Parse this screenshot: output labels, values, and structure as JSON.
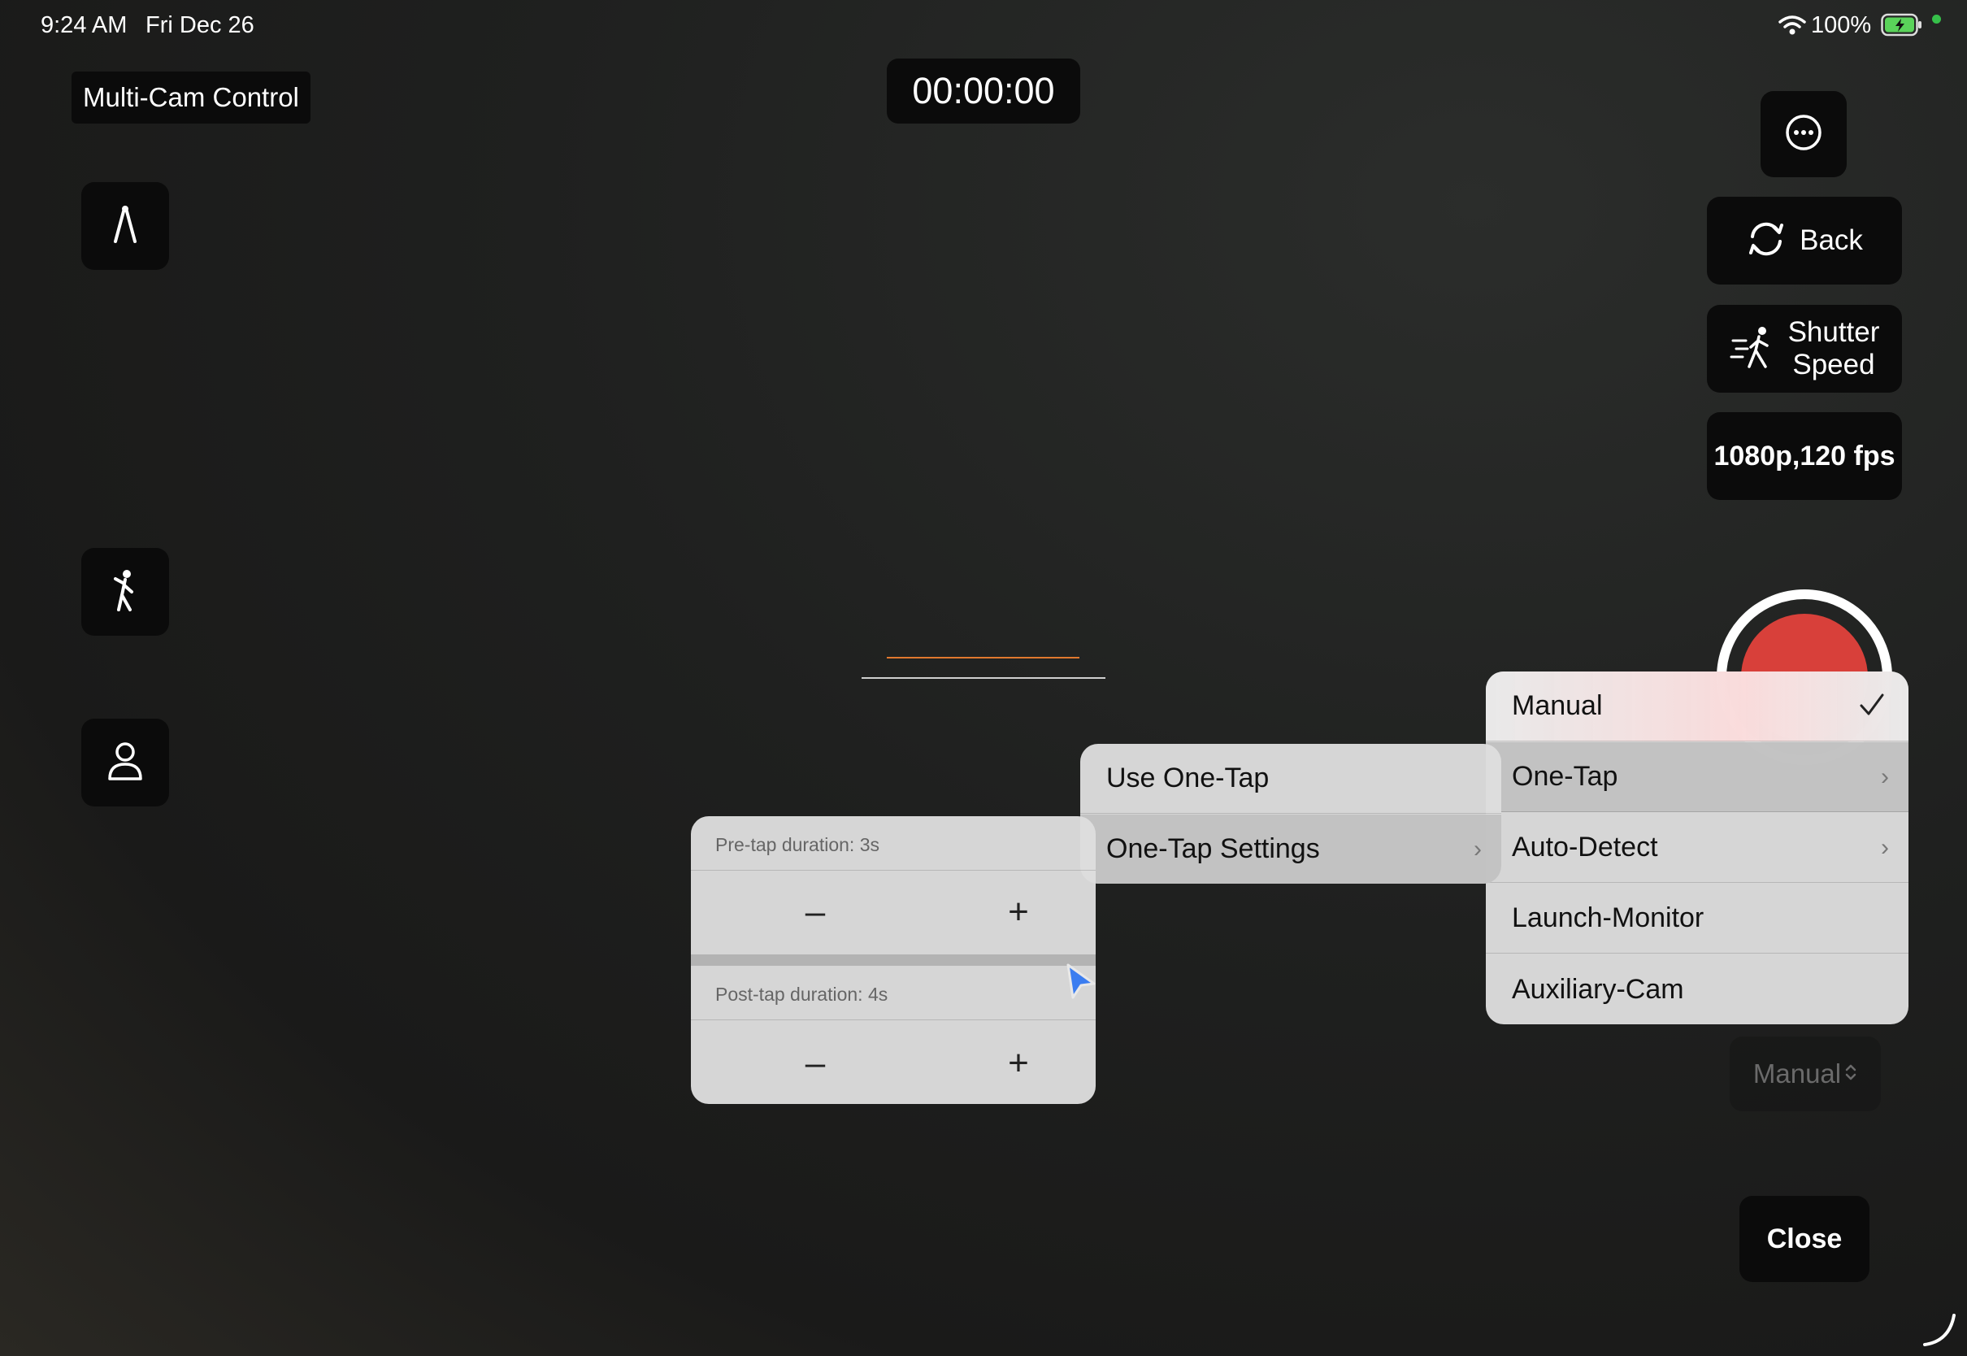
{
  "status_bar": {
    "time": "9:24 AM",
    "date": "Fri Dec 26",
    "battery": "100%"
  },
  "header": {
    "title": "Multi-Cam Control",
    "timer": "00:00:00"
  },
  "right_controls": {
    "back_label": "Back",
    "shutter_label_line1": "Shutter",
    "shutter_label_line2": "Speed",
    "format_label": "1080p,120 fps",
    "mode_selector_label": "Manual",
    "close_label": "Close"
  },
  "mode_menu": {
    "items": [
      {
        "label": "Manual",
        "checked": true
      },
      {
        "label": "One-Tap",
        "submenu": true
      },
      {
        "label": "Auto-Detect",
        "submenu": true
      },
      {
        "label": "Launch-Monitor"
      },
      {
        "label": "Auxiliary-Cam"
      }
    ]
  },
  "one_tap_menu": {
    "items": [
      {
        "label": "Use One-Tap"
      },
      {
        "label": "One-Tap Settings",
        "submenu": true
      }
    ]
  },
  "settings_panel": {
    "pre_tap_label": "Pre-tap duration: 3s",
    "post_tap_label": "Post-tap duration: 4s",
    "minus": "–",
    "plus": "+"
  },
  "colors": {
    "record": "#d8403a",
    "accent_line": "#e0782e",
    "battery": "#5ad35a",
    "cursor": "#3b7df0"
  },
  "icons": [
    "wifi-icon",
    "battery-icon",
    "ellipsis-circle-icon",
    "rotate-camera-icon",
    "running-figure-icon",
    "compass-icon",
    "golfer-icon",
    "person-icon",
    "checkmark-icon",
    "chevron-right-icon",
    "chevron-updown-icon",
    "pointer-cursor-icon"
  ]
}
